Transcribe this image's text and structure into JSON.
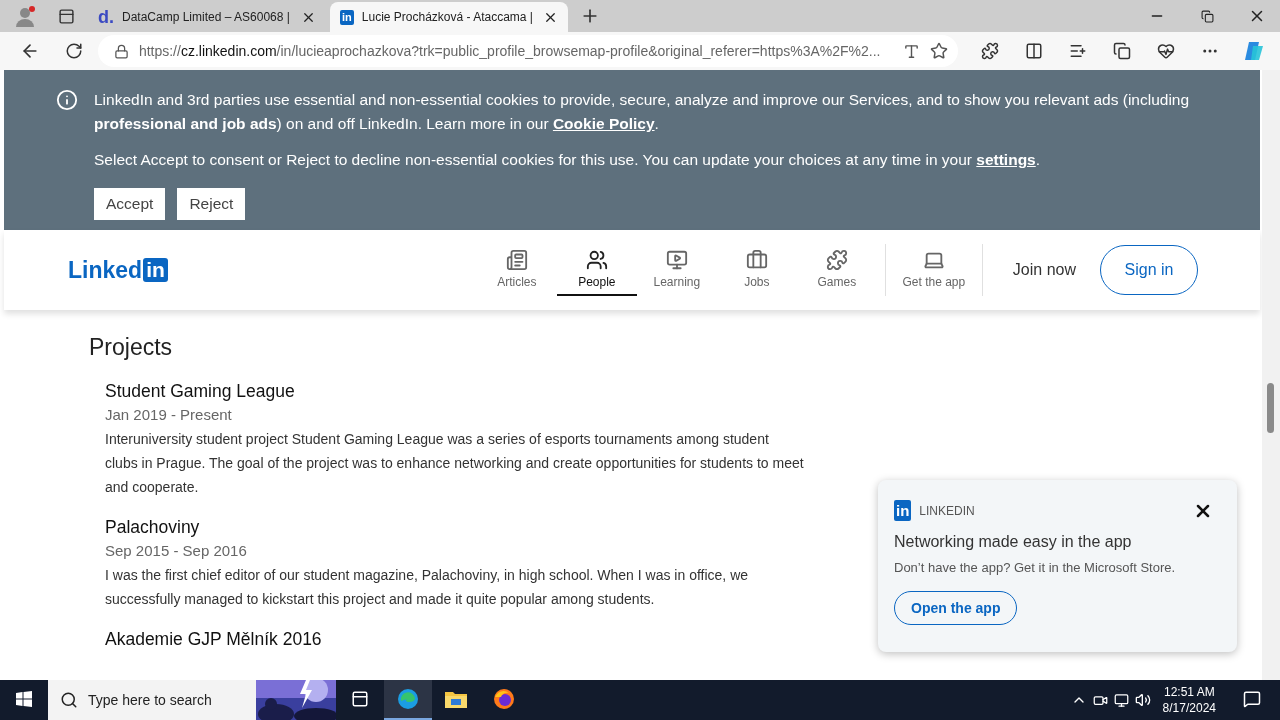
{
  "browser": {
    "tabs": [
      {
        "favicon": "d.",
        "title": "DataCamp Limited – AS60068 |",
        "selected": false
      },
      {
        "favicon": "in",
        "title": "Lucie Procházková - Ataccama | ",
        "selected": true
      }
    ],
    "address": {
      "scheme": "https://",
      "host": "cz.linkedin.com",
      "rest": "/in/lucieaprochazkova?trk=public_profile_browsemap-profile&original_referer=https%3A%2F%2..."
    }
  },
  "cookie_banner": {
    "text": "LinkedIn and 3rd parties use essential and non-essential cookies to provide, secure, analyze and improve our Services, and to show you relevant ads (including **professional and job ads**) on and off LinkedIn. Learn more in our ",
    "link": "Cookie Policy",
    "text_after": ".",
    "text2": "Select Accept to consent or Reject to decline non-essential cookies for this use. You can update your choices at any time in your ",
    "link2": "settings",
    "text2_after": ".",
    "buttons": [
      "Accept",
      "Reject"
    ]
  },
  "header": {
    "logo": {
      "word": "Linked",
      "box": "in"
    },
    "nav": [
      {
        "label": "Articles",
        "selected": false
      },
      {
        "label": "People",
        "selected": true
      },
      {
        "label": "Learning",
        "selected": false
      },
      {
        "label": "Jobs",
        "selected": false
      },
      {
        "label": "Games",
        "selected": false
      },
      {
        "label": "Get the app",
        "selected": false
      }
    ],
    "join": "Join now",
    "sign_in": "Sign in"
  },
  "projects": {
    "title": "Projects",
    "items": [
      {
        "name": "Student Gaming League",
        "dates": "Jan 2019 - Present",
        "description": "Interuniversity student project Student Gaming League was a series of esports tournaments among student clubs in Prague. The goal of the project was to enhance networking and create opportunities for students to meet and cooperate."
      },
      {
        "name": "Palachoviny",
        "dates": "Sep 2015 - Sep 2016",
        "description": "I was the first chief editor of our student magazine, Palachoviny, in high school. When I was in office, we successfully managed to kickstart this project and made it quite popular among students."
      },
      {
        "name": "Akademie GJP Mělník 2016"
      }
    ]
  },
  "popup": {
    "logo": "in",
    "source": "LINKEDIN",
    "title": "Networking made easy in the app",
    "text": "Don’t have the app? Get it in the Microsoft Store.",
    "button": "Open the app"
  },
  "taskbar": {
    "search": {
      "placeholder": "Type here to search"
    },
    "apps": [
      {
        "selected": false
      },
      {
        "selected": true
      },
      {
        "selected": false
      },
      {
        "selected": false
      }
    ],
    "time": "12:51 AM",
    "date": "8/17/2024"
  }
}
